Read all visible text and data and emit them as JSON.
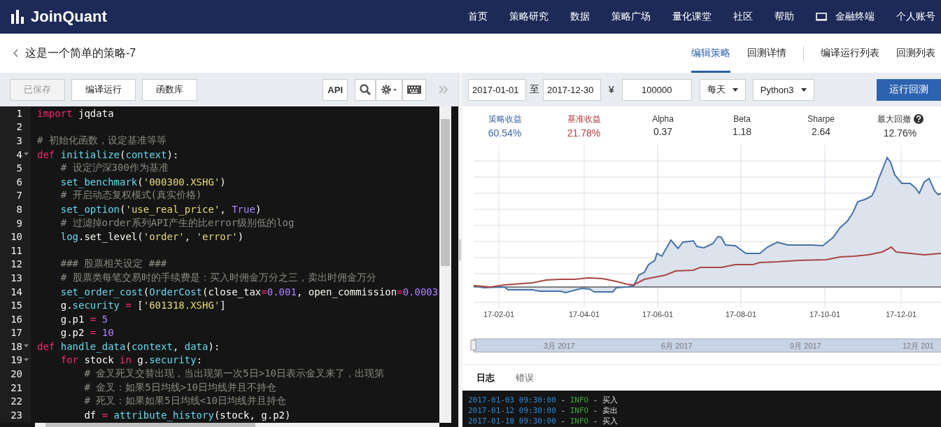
{
  "header": {
    "logo": "JoinQuant",
    "nav": [
      {
        "label": "首页",
        "kind": "link"
      },
      {
        "label": "策略研究",
        "kind": "link"
      },
      {
        "label": "数据",
        "kind": "link"
      },
      {
        "label": "策略广场",
        "kind": "link"
      },
      {
        "label": "量化课堂",
        "kind": "link"
      },
      {
        "label": "社区",
        "kind": "link"
      },
      {
        "label": "帮助",
        "kind": "link"
      },
      {
        "label": "金融终端",
        "kind": "terminal"
      },
      {
        "label": "个人账号",
        "kind": "link"
      }
    ]
  },
  "title_bar": {
    "title": "这是一个简单的策略-7",
    "tabs": [
      {
        "label": "编辑策略",
        "selected": true
      },
      {
        "label": "回测详情",
        "selected": false
      },
      {
        "label": "编译运行列表",
        "selected": false
      },
      {
        "label": "回测列表",
        "selected": false
      }
    ]
  },
  "editor_toolbar": {
    "buttons": [
      {
        "label": "已保存",
        "disabled": true
      },
      {
        "label": "编译运行",
        "disabled": false
      },
      {
        "label": "函数库",
        "disabled": false
      }
    ],
    "api": "API"
  },
  "code": [
    {
      "number": "1",
      "fold": false,
      "tokens": [
        {
          "text": "import",
          "kind": "k"
        },
        {
          "text": " jqdata",
          "kind": "p"
        }
      ]
    },
    {
      "number": "2",
      "fold": false
    },
    {
      "number": "3",
      "fold": false,
      "tokens": [
        {
          "text": "# 初始化函数，设定基准等等",
          "kind": "c"
        }
      ]
    },
    {
      "number": "4",
      "fold": true,
      "tokens": [
        {
          "text": "def",
          "kind": "k"
        },
        {
          "text": " initialize",
          "kind": "f"
        },
        {
          "text": "(",
          "kind": "p"
        },
        {
          "text": "context",
          "kind": "f"
        },
        {
          "text": "):",
          "kind": "p"
        }
      ]
    },
    {
      "number": "5",
      "fold": false,
      "tokens": [
        {
          "text": "    # 设定沪深300作为基准",
          "kind": "c"
        }
      ]
    },
    {
      "number": "6",
      "fold": false,
      "tokens": [
        {
          "text": "    set_benchmark",
          "kind": "f"
        },
        {
          "text": "(",
          "kind": "p"
        },
        {
          "text": "'000300.XSHG'",
          "kind": "s"
        },
        {
          "text": ")",
          "kind": "p"
        }
      ]
    },
    {
      "number": "7",
      "fold": false,
      "tokens": [
        {
          "text": "    # 开启动态复权模式(真实价格)",
          "kind": "c"
        }
      ]
    },
    {
      "number": "8",
      "fold": false,
      "tokens": [
        {
          "text": "    set_option",
          "kind": "f"
        },
        {
          "text": "(",
          "kind": "p"
        },
        {
          "text": "'use_real_price'",
          "kind": "s"
        },
        {
          "text": ", ",
          "kind": "p"
        },
        {
          "text": "True",
          "kind": "n"
        },
        {
          "text": ")",
          "kind": "p"
        }
      ]
    },
    {
      "number": "9",
      "fold": false,
      "tokens": [
        {
          "text": "    # 过滤掉order系列API产生的比error级别低的log",
          "kind": "c"
        }
      ]
    },
    {
      "number": "10",
      "fold": false,
      "tokens": [
        {
          "text": "    log",
          "kind": "f"
        },
        {
          "text": ".set_level(",
          "kind": "p"
        },
        {
          "text": "'order'",
          "kind": "s"
        },
        {
          "text": ", ",
          "kind": "p"
        },
        {
          "text": "'error'",
          "kind": "s"
        },
        {
          "text": ")",
          "kind": "p"
        }
      ]
    },
    {
      "number": "11",
      "fold": false
    },
    {
      "number": "12",
      "fold": false,
      "tokens": [
        {
          "text": "    ### 股票相关设定 ###",
          "kind": "c"
        }
      ]
    },
    {
      "number": "13",
      "fold": false,
      "tokens": [
        {
          "text": "    # 股票类每笔交易时的手续费是：买入时佣金万分之三，卖出时佣金万分",
          "kind": "c"
        }
      ]
    },
    {
      "number": "14",
      "fold": false,
      "tokens": [
        {
          "text": "    set_order_cost",
          "kind": "f"
        },
        {
          "text": "(",
          "kind": "p"
        },
        {
          "text": "OrderCost",
          "kind": "f"
        },
        {
          "text": "(close_tax",
          "kind": "p"
        },
        {
          "text": "=",
          "kind": "o"
        },
        {
          "text": "0.001",
          "kind": "n"
        },
        {
          "text": ", open_commission",
          "kind": "p"
        },
        {
          "text": "=",
          "kind": "o"
        },
        {
          "text": "0.0003",
          "kind": "n"
        }
      ]
    },
    {
      "number": "15",
      "fold": false,
      "tokens": [
        {
          "text": "    g.",
          "kind": "p"
        },
        {
          "text": "security",
          "kind": "f"
        },
        {
          "text": " = ",
          "kind": "o"
        },
        {
          "text": "[",
          "kind": "p"
        },
        {
          "text": "'601318.XSHG'",
          "kind": "s"
        },
        {
          "text": "]",
          "kind": "p"
        }
      ]
    },
    {
      "number": "16",
      "fold": false,
      "tokens": [
        {
          "text": "    g.p1",
          "kind": "p"
        },
        {
          "text": " = ",
          "kind": "o"
        },
        {
          "text": "5",
          "kind": "n"
        }
      ]
    },
    {
      "number": "17",
      "fold": false,
      "tokens": [
        {
          "text": "    g.p2",
          "kind": "p"
        },
        {
          "text": " = ",
          "kind": "o"
        },
        {
          "text": "10",
          "kind": "n"
        }
      ]
    },
    {
      "number": "18",
      "fold": true,
      "tokens": [
        {
          "text": "def",
          "kind": "k"
        },
        {
          "text": " handle_data",
          "kind": "f"
        },
        {
          "text": "(",
          "kind": "p"
        },
        {
          "text": "context",
          "kind": "f"
        },
        {
          "text": ", ",
          "kind": "p"
        },
        {
          "text": "data",
          "kind": "f"
        },
        {
          "text": "):",
          "kind": "p"
        }
      ]
    },
    {
      "number": "19",
      "fold": true,
      "tokens": [
        {
          "text": "    for",
          "kind": "k"
        },
        {
          "text": " stock ",
          "kind": "p"
        },
        {
          "text": "in",
          "kind": "k"
        },
        {
          "text": " g.",
          "kind": "p"
        },
        {
          "text": "security",
          "kind": "f"
        },
        {
          "text": ":",
          "kind": "p"
        }
      ]
    },
    {
      "number": "20",
      "fold": false,
      "tokens": [
        {
          "text": "        # 金叉死叉交替出现，当出现第一次5日>10日表示金叉来了，出现第",
          "kind": "c"
        }
      ]
    },
    {
      "number": "21",
      "fold": false,
      "tokens": [
        {
          "text": "        # 金叉：如果5日均线>10日均线并且不持仓",
          "kind": "c"
        }
      ]
    },
    {
      "number": "22",
      "fold": false,
      "tokens": [
        {
          "text": "        # 死叉：如果如果5日均线<10日均线并且持仓",
          "kind": "c"
        }
      ]
    },
    {
      "number": "23",
      "fold": false,
      "tokens": [
        {
          "text": "        df",
          "kind": "p"
        },
        {
          "text": " = ",
          "kind": "o"
        },
        {
          "text": "attribute_history",
          "kind": "f"
        },
        {
          "text": "(stock, g.p2)",
          "kind": "p"
        }
      ]
    }
  ],
  "backtest_toolbar": {
    "start_date": "2017-01-01",
    "to": "至",
    "end_date": "2017-12-30",
    "currency": "¥",
    "capital": "100000",
    "frequency": "每天",
    "language": "Python3",
    "run": "运行回测"
  },
  "stats": [
    {
      "label": "策略收益",
      "value": "60.54%",
      "color": "#3d6aa6",
      "help": false
    },
    {
      "label": "基准收益",
      "value": "21.78%",
      "color": "#b0413e",
      "help": false
    },
    {
      "label": "Alpha",
      "value": "0.37",
      "color": "#333333",
      "help": false
    },
    {
      "label": "Beta",
      "value": "1.18",
      "color": "#333333",
      "help": false
    },
    {
      "label": "Sharpe",
      "value": "2.64",
      "color": "#333333",
      "help": false
    },
    {
      "label": "最大回撤",
      "value": "12.76%",
      "color": "#333333",
      "help": true
    }
  ],
  "chart": {
    "x_labels": [
      "17-02-01",
      "17-04-01",
      "17-06-01",
      "17-08-01",
      "17-10-01",
      "17-12-01"
    ],
    "navigator_labels": [
      "3月 2017",
      "6月 2017",
      "9月 2017",
      "12月 201"
    ]
  },
  "log_tabs": [
    {
      "label": "日志",
      "selected": true
    },
    {
      "label": "错误",
      "selected": false
    }
  ],
  "log": [
    {
      "time": "2017-01-03 09:30:00",
      "time_sep": "-",
      "level": "INFO",
      "level_sep": "-",
      "message": "买入"
    },
    {
      "time": "2017-01-12 09:30:00",
      "time_sep": "-",
      "level": "INFO",
      "level_sep": "-",
      "message": "卖出"
    },
    {
      "time": "2017-01-18 09:30:00",
      "time_sep": "-",
      "level": "INFO",
      "level_sep": "-",
      "message": "买入"
    }
  ]
}
